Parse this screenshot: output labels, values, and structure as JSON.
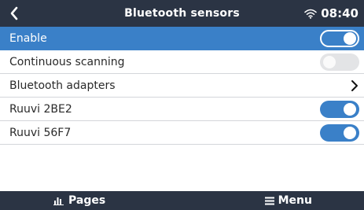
{
  "header": {
    "title": "Bluetooth sensors",
    "time": "08:40"
  },
  "rows": [
    {
      "label": "Enable",
      "control": "toggle",
      "state": "on",
      "selected": true
    },
    {
      "label": "Continuous scanning",
      "control": "toggle",
      "state": "off",
      "selected": false
    },
    {
      "label": "Bluetooth adapters",
      "control": "chevron",
      "selected": false
    },
    {
      "label": "Ruuvi 2BE2",
      "control": "toggle",
      "state": "on",
      "selected": false
    },
    {
      "label": "Ruuvi 56F7",
      "control": "toggle",
      "state": "on",
      "selected": false
    }
  ],
  "bottombar": {
    "pages_label": "Pages",
    "menu_label": "Menu"
  },
  "icons": {
    "back": "chevron-left-icon",
    "wifi": "wifi-icon",
    "chevron_right": "chevron-right-icon",
    "pages": "bar-chart-icon",
    "menu": "hamburger-menu-icon"
  },
  "colors": {
    "header_bg": "#2b3444",
    "accent": "#3a80c8",
    "toggle_off": "#e3e4e6",
    "divider": "#d4d6da"
  }
}
